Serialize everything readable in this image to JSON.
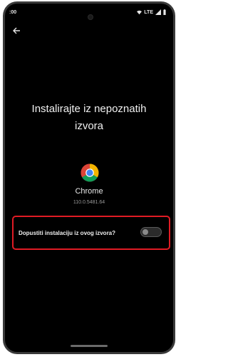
{
  "statusbar": {
    "time": ":00",
    "network": "LTE"
  },
  "page": {
    "title_line1": "Instalirajte iz nepoznatih",
    "title_line2": "izvora"
  },
  "app": {
    "name": "Chrome",
    "version": "110.0.5481.64",
    "icon": "chrome-logo"
  },
  "setting": {
    "label": "Dopustiti instalaciju iz ovog izvora?",
    "enabled": false,
    "highlight_color": "#e01b24"
  },
  "icons": {
    "back": "back-arrow-icon",
    "wifi": "wifi-icon",
    "signal": "signal-icon",
    "battery": "battery-icon"
  }
}
